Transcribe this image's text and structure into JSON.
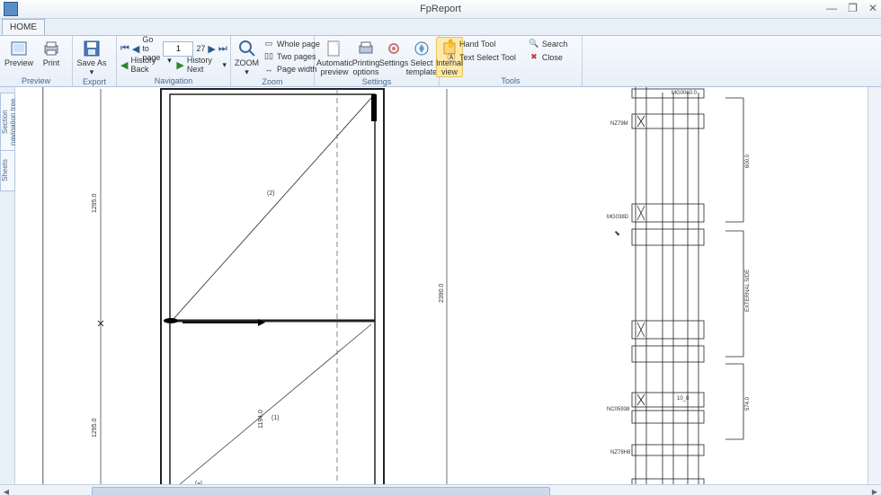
{
  "app": {
    "title": "FpReport"
  },
  "window": {
    "minimize": "—",
    "restore": "❐",
    "close": "✕"
  },
  "tabs": {
    "home": "HOME"
  },
  "ribbon": {
    "preview": {
      "label": "Preview",
      "print_label": "Print",
      "group": "Preview"
    },
    "export": {
      "saveas_label": "Save As",
      "group": "Export"
    },
    "nav": {
      "goto": "Go to page",
      "page_current": "1",
      "page_total": "27",
      "history_back": "History Back",
      "history_next": "History Next",
      "group": "Navigation"
    },
    "zoom": {
      "zoom_label": "ZOOM",
      "whole_page": "Whole page",
      "two_pages": "Two pages",
      "page_width": "Page width",
      "group": "Zoom"
    },
    "settings": {
      "auto_preview": "Automatic preview",
      "print_options": "Printing options",
      "settings_label": "Settings",
      "select_template": "Select template",
      "internal_view": "Internal view",
      "group": "Settings"
    },
    "tools": {
      "hand": "Hand Tool",
      "text_select": "Text Select Tool",
      "search": "Search",
      "close": "Close",
      "group": "Tools"
    }
  },
  "sidebar": {
    "tab1": "Section navigation tree",
    "tab2": "Sheets"
  },
  "drawing": {
    "dim_left_upper": "1295.0",
    "dim_left_lower": "1295.0",
    "dim_h_mid": "1194.0",
    "dim_right": "2390.0",
    "panel_1": "(1)",
    "panel_2": "(2)",
    "panel_a": "[a]",
    "sect_labels": {
      "l1": "MG0060.0",
      "l2": "NZ79M",
      "l3": "MG038D",
      "l4": "NC05938",
      "l5": "NZ78H8",
      "l6": "10_8"
    },
    "side_span1": "600.0",
    "side_span2": "EXTERNAL SIDE",
    "side_span3": "574.0"
  }
}
